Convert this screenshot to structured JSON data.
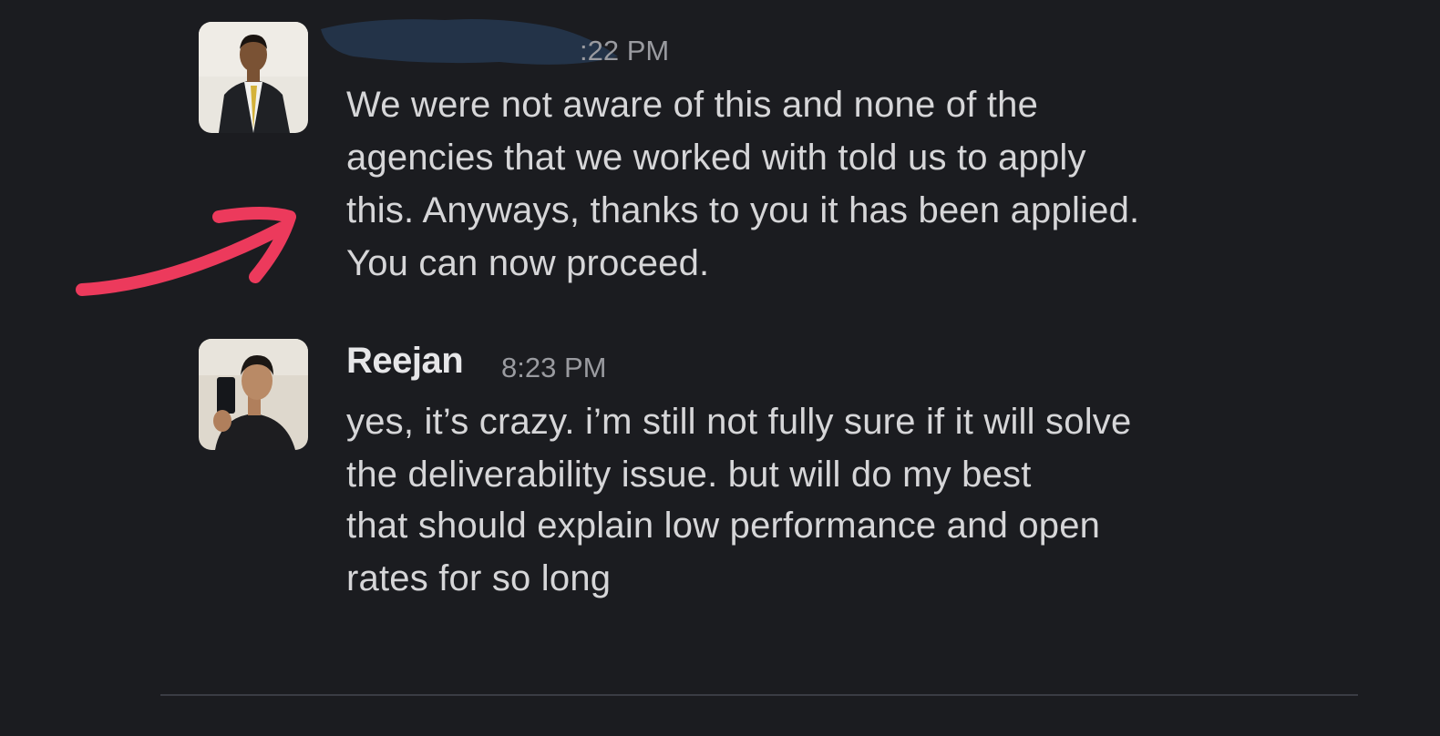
{
  "messages": [
    {
      "sender": "",
      "time": ":22 PM",
      "avatar": "avatar-man-in-suit",
      "lines": [
        "We were not aware of this and none of the",
        "agencies that we worked with told us to apply",
        "this. Anyways, thanks to you it has been applied.",
        "You can now proceed."
      ]
    },
    {
      "sender": "Reejan",
      "time": "8:23 PM",
      "avatar": "avatar-selfie",
      "lines": [
        "yes, it’s crazy. i’m still not fully sure if it will solve",
        "the deliverability issue. but will do my best"
      ],
      "followup_lines": [
        "that should explain low performance and open",
        "rates for so long"
      ]
    }
  ],
  "colors": {
    "background": "#1b1c20",
    "text": "#d6d6d8",
    "timestamp": "#9a9ba0",
    "redaction": "#233348",
    "annotation_arrow": "#ec3a5c"
  }
}
